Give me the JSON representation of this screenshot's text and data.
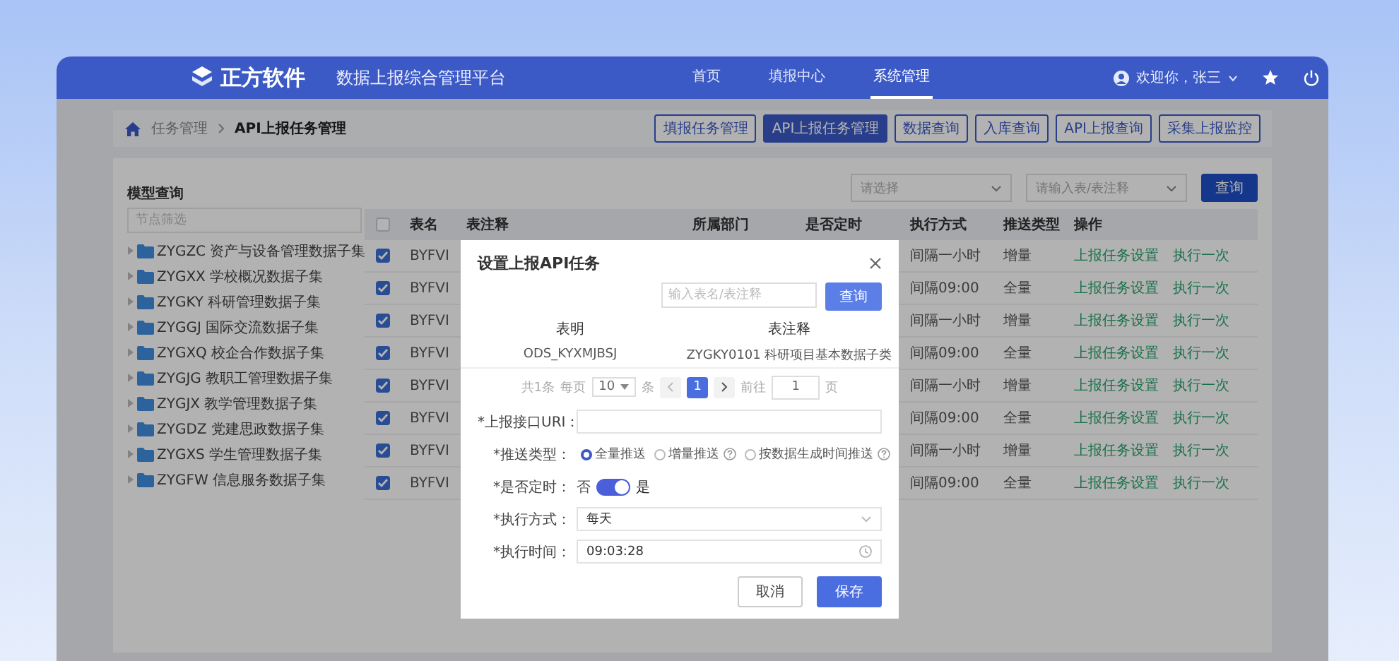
{
  "header": {
    "logo": "正方软件",
    "title": "数据上报综合管理平台",
    "nav": [
      {
        "label": "首页",
        "selected": false
      },
      {
        "label": "填报中心",
        "selected": false
      },
      {
        "label": "系统管理",
        "selected": true
      }
    ],
    "user": "欢迎你，张三"
  },
  "breadcrumb": [
    "任务管理",
    "API上报任务管理"
  ],
  "quick_buttons": [
    {
      "label": "填报任务管理",
      "selected": false
    },
    {
      "label": "API上报任务管理",
      "selected": true
    },
    {
      "label": "数据查询",
      "selected": false
    },
    {
      "label": "入库查询",
      "selected": false
    },
    {
      "label": "API上报查询",
      "selected": false
    },
    {
      "label": "采集上报监控",
      "selected": false
    }
  ],
  "tree": {
    "title": "模型查询",
    "placeholder": "节点筛选",
    "items": [
      "ZYGZC 资产与设备管理数据子集",
      "ZYGXX 学校概况数据子集",
      "ZYGKY 科研管理数据子集",
      "ZYGGJ 国际交流数据子集",
      "ZYGXQ 校企合作数据子集",
      "ZYGJG 教职工管理数据子集",
      "ZYGJX 教学管理数据子集",
      "ZYGDZ 党建思政数据子集",
      "ZYGXS 学生管理数据子集",
      "ZYGFW 信息服务数据子集"
    ]
  },
  "filters": [
    {
      "placeholder": "请选择"
    },
    {
      "placeholder": "请输入表/表注释"
    }
  ],
  "query_button": "查询",
  "table": {
    "all_checked": false,
    "columns": [
      "表名",
      "表注释",
      "所属部门",
      "是否定时",
      "执行方式",
      "推送类型",
      "操作"
    ],
    "rows": [
      {
        "checked": true,
        "name": "BYFVI",
        "mode": "间隔一小时",
        "push": "增量",
        "actions": [
          "上报任务设置",
          "执行一次"
        ]
      },
      {
        "checked": true,
        "name": "BYFVI",
        "mode": "间隔09:00",
        "push": "全量",
        "actions": [
          "上报任务设置",
          "执行一次"
        ]
      },
      {
        "checked": true,
        "name": "BYFVI",
        "mode": "间隔一小时",
        "push": "增量",
        "actions": [
          "上报任务设置",
          "执行一次"
        ]
      },
      {
        "checked": true,
        "name": "BYFVI",
        "mode": "间隔09:00",
        "push": "全量",
        "actions": [
          "上报任务设置",
          "执行一次"
        ]
      },
      {
        "checked": true,
        "name": "BYFVI",
        "mode": "间隔一小时",
        "push": "增量",
        "actions": [
          "上报任务设置",
          "执行一次"
        ]
      },
      {
        "checked": true,
        "name": "BYFVI",
        "mode": "间隔09:00",
        "push": "全量",
        "actions": [
          "上报任务设置",
          "执行一次"
        ]
      },
      {
        "checked": true,
        "name": "BYFVI",
        "mode": "间隔一小时",
        "push": "增量",
        "actions": [
          "上报任务设置",
          "执行一次"
        ]
      },
      {
        "checked": true,
        "name": "BYFVI",
        "mode": "间隔09:00",
        "push": "全量",
        "actions": [
          "上报任务设置",
          "执行一次"
        ]
      }
    ]
  },
  "dialog": {
    "title": "设置上报API任务",
    "search_placeholder": "输入表名/表注释",
    "search_button": "查询",
    "columns": [
      "表明",
      "表注释"
    ],
    "rows": [
      [
        "ODS_KYXMJBSJ",
        "ZYGKY0101 科研项目基本数据子类"
      ]
    ],
    "pagination": {
      "total": "共1条",
      "per": "每页",
      "size": "10",
      "unit": "条",
      "pages": [
        {
          "label": "1",
          "selected": true
        }
      ],
      "goto": "前往",
      "page": "1",
      "page_unit": "页"
    },
    "fields": [
      {
        "kind": "text",
        "label": "*上报接口URI："
      },
      {
        "kind": "radio",
        "label": "*推送类型：",
        "options": [
          {
            "label": "全量推送",
            "selected": true,
            "help": false
          },
          {
            "label": "增量推送",
            "selected": false,
            "help": true
          },
          {
            "label": "按数据生成时间推送",
            "selected": false,
            "help": true
          }
        ]
      },
      {
        "kind": "switch",
        "label": "*是否定时：",
        "off_label": "否",
        "on_label": "是",
        "on": true
      },
      {
        "kind": "select",
        "label": "*执行方式：",
        "value": "每天"
      },
      {
        "kind": "time",
        "label": "*执行时间：",
        "value": "09:03:28"
      }
    ],
    "buttons": [
      {
        "kind": "cancel",
        "label": "取消"
      },
      {
        "kind": "primary",
        "label": "保存"
      }
    ]
  }
}
